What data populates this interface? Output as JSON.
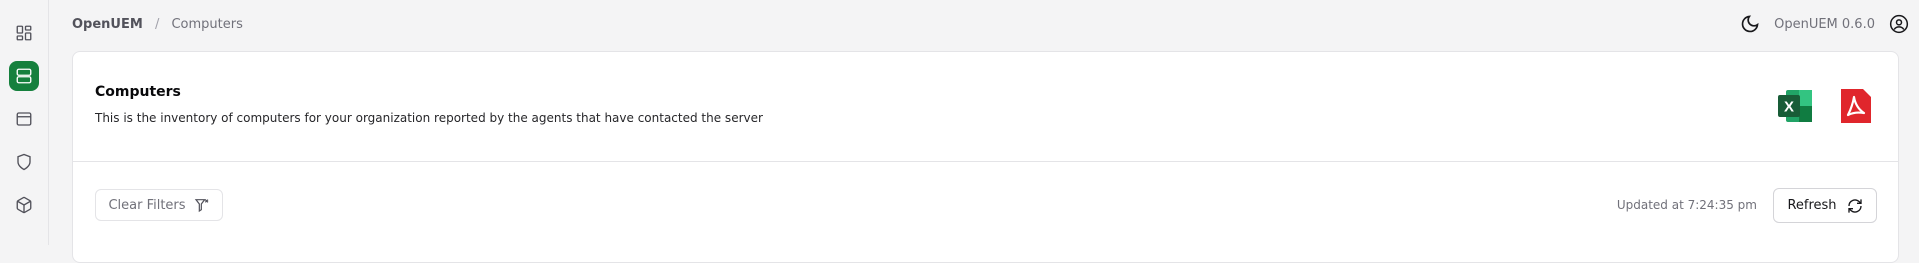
{
  "breadcrumb": {
    "root": "OpenUEM",
    "separator": "/",
    "current": "Computers"
  },
  "header": {
    "version": "OpenUEM 0.6.0",
    "theme_icon": "moon-icon",
    "user_icon": "user-circle-icon"
  },
  "sidebar": {
    "items": [
      {
        "name": "dashboard",
        "icon": "dashboard-grid-icon",
        "active": false
      },
      {
        "name": "computers",
        "icon": "server-icon",
        "active": true
      },
      {
        "name": "browser",
        "icon": "window-icon",
        "active": false
      },
      {
        "name": "security",
        "icon": "shield-icon",
        "active": false
      },
      {
        "name": "software",
        "icon": "package-icon",
        "active": false
      }
    ]
  },
  "card": {
    "title": "Computers",
    "description": "This is the inventory of computers for your organization reported by the agents that have contacted the server",
    "exports": [
      {
        "name": "excel-export",
        "icon": "excel-icon",
        "color": "#1d6f42"
      },
      {
        "name": "pdf-export",
        "icon": "pdf-icon",
        "color": "#e0262c"
      }
    ]
  },
  "toolbar": {
    "clear_filters": "Clear Filters",
    "updated": "Updated at 7:24:35 pm",
    "refresh": "Refresh"
  },
  "colors": {
    "accent": "#15803d",
    "background": "#f4f4f5",
    "border": "#e4e4e7"
  }
}
